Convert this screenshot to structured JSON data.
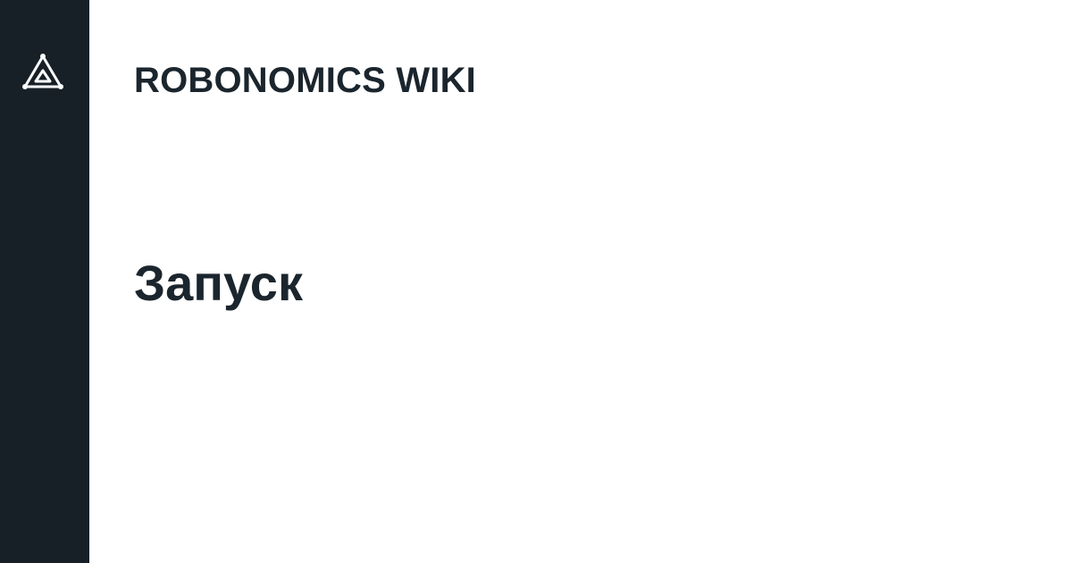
{
  "brand": {
    "logo_icon": "robonomics-triangle-logo-icon",
    "site_name": "ROBONOMICS WIKI",
    "sidebar_color": "#172027",
    "text_color": "#1b252d"
  },
  "page": {
    "title": "Запуск"
  }
}
